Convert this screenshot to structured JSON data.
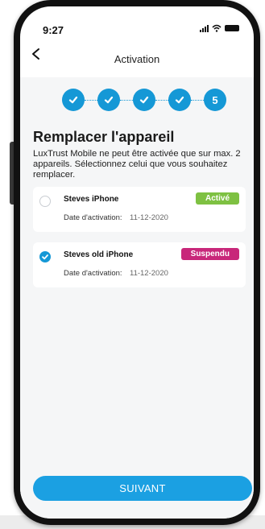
{
  "status_bar": {
    "time": "9:27"
  },
  "nav": {
    "title": "Activation",
    "back_icon": "chevron-left-icon"
  },
  "stepper": {
    "steps": [
      {
        "state": "done",
        "icon": "check-icon"
      },
      {
        "state": "done",
        "icon": "check-icon"
      },
      {
        "state": "done",
        "icon": "check-icon"
      },
      {
        "state": "done",
        "icon": "check-icon"
      },
      {
        "state": "current",
        "label": "5"
      }
    ]
  },
  "page": {
    "heading": "Remplacer l'appareil",
    "description": "LuxTrust Mobile ne peut être activée que sur max. 2 appareils. Sélectionnez celui que vous souhaitez remplacer."
  },
  "devices": [
    {
      "name": "Steves iPhone",
      "status": "Activé",
      "status_color": "#7ec142",
      "date_label": "Date d'activation:",
      "date_value": "11-12-2020",
      "selected": false
    },
    {
      "name": "Steves old iPhone",
      "status": "Suspendu",
      "status_color": "#c8277a",
      "date_label": "Date d'activation:",
      "date_value": "11-12-2020",
      "selected": true
    }
  ],
  "footer": {
    "next_label": "SUIVANT"
  },
  "colors": {
    "accent": "#1598d6",
    "button": "#1ba0e2",
    "background": "#f5f6f7"
  }
}
